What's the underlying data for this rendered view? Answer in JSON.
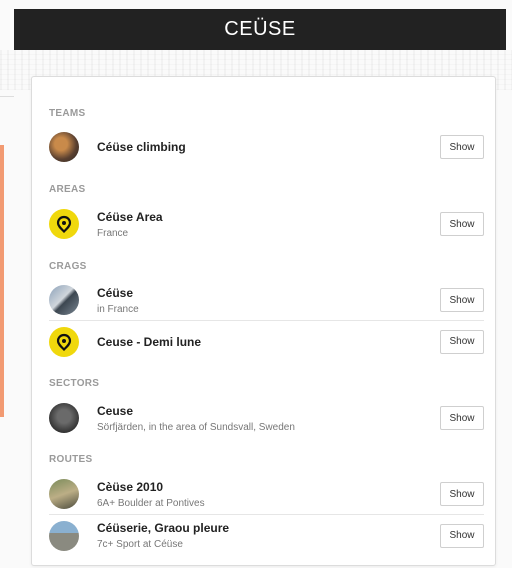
{
  "header": {
    "title": "CEÜSE"
  },
  "sections": {
    "teams": {
      "label": "TEAMS",
      "items": [
        {
          "title": "Céüse climbing",
          "subtitle": "",
          "show": "Show",
          "icon": "team-photo"
        }
      ]
    },
    "areas": {
      "label": "AREAS",
      "items": [
        {
          "title": "Céüse Area",
          "subtitle": "France",
          "show": "Show",
          "icon": "location-pin-icon"
        }
      ]
    },
    "crags": {
      "label": "CRAGS",
      "items": [
        {
          "title": "Céüse",
          "subtitle": "in France",
          "show": "Show",
          "icon": "crag-photo"
        },
        {
          "title": "Ceuse - Demi lune",
          "subtitle": "",
          "show": "Show",
          "icon": "location-pin-icon"
        }
      ]
    },
    "sectors": {
      "label": "SECTORS",
      "items": [
        {
          "title": "Ceuse",
          "subtitle": "Sörfjärden, in the area of Sundsvall, Sweden",
          "show": "Show",
          "icon": "sector-photo"
        }
      ]
    },
    "routes": {
      "label": "ROUTES",
      "items": [
        {
          "title": "Cèüse 2010",
          "subtitle": "6A+ Boulder at Pontives",
          "show": "Show",
          "icon": "route-photo"
        },
        {
          "title": "Céüserie, Graou pleure",
          "subtitle": "7c+ Sport at Céüse",
          "show": "Show",
          "icon": "route-photo"
        }
      ]
    }
  },
  "colors": {
    "header_bg": "#222222",
    "pin_yellow": "#f0d80c",
    "accent": "#f29a72"
  }
}
